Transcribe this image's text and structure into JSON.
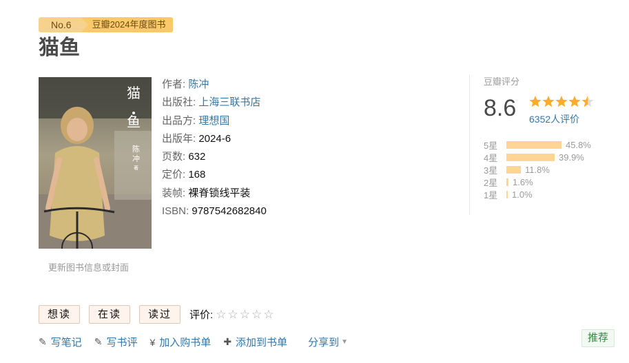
{
  "ribbon": {
    "rank": "No.6",
    "label": "豆瓣2024年度图书"
  },
  "book": {
    "title": "猫鱼",
    "cover_title_chars": [
      "猫",
      "鱼"
    ],
    "cover_author_chars": [
      "陈",
      "冲"
    ],
    "cover_author_suffix": "著",
    "update_link": "更新图书信息或封面"
  },
  "info": {
    "author_label": "作者:",
    "author": "陈冲",
    "publisher_label": "出版社:",
    "publisher": "上海三联书店",
    "producer_label": "出品方:",
    "producer": "理想国",
    "year_label": "出版年:",
    "year": "2024-6",
    "pages_label": "页数:",
    "pages": "632",
    "price_label": "定价:",
    "price": "168",
    "binding_label": "装帧:",
    "binding": "裸脊锁线平装",
    "isbn_label": "ISBN:",
    "isbn": "9787542682840"
  },
  "rating": {
    "label": "豆瓣评分",
    "score": "8.6",
    "stars_value": 4.5,
    "votes": "6352人评价",
    "distribution": [
      {
        "label": "5星",
        "pct": "45.8%",
        "value": 45.8
      },
      {
        "label": "4星",
        "pct": "39.9%",
        "value": 39.9
      },
      {
        "label": "3星",
        "pct": "11.8%",
        "value": 11.8
      },
      {
        "label": "2星",
        "pct": "1.6%",
        "value": 1.6
      },
      {
        "label": "1星",
        "pct": "1.0%",
        "value": 1.0
      }
    ]
  },
  "actions": {
    "want": "想读",
    "reading": "在读",
    "read": "读过",
    "rate_label": "评价:",
    "rate_stars": [
      "☆",
      "☆",
      "☆",
      "☆",
      "☆"
    ]
  },
  "ops": {
    "note_icon": "✎",
    "note": "写笔记",
    "review_icon": "✎",
    "review": "写书评",
    "cart_icon": "¥",
    "cart": "加入购书单",
    "list_icon": "✚",
    "list": "添加到书单",
    "share": "分享到",
    "share_caret": "▼"
  },
  "recommend": "推荐",
  "colors": {
    "link": "#3377aa",
    "bar": "#ffd596",
    "star": "#ffac2d",
    "ribbon": "#f9c96b"
  }
}
